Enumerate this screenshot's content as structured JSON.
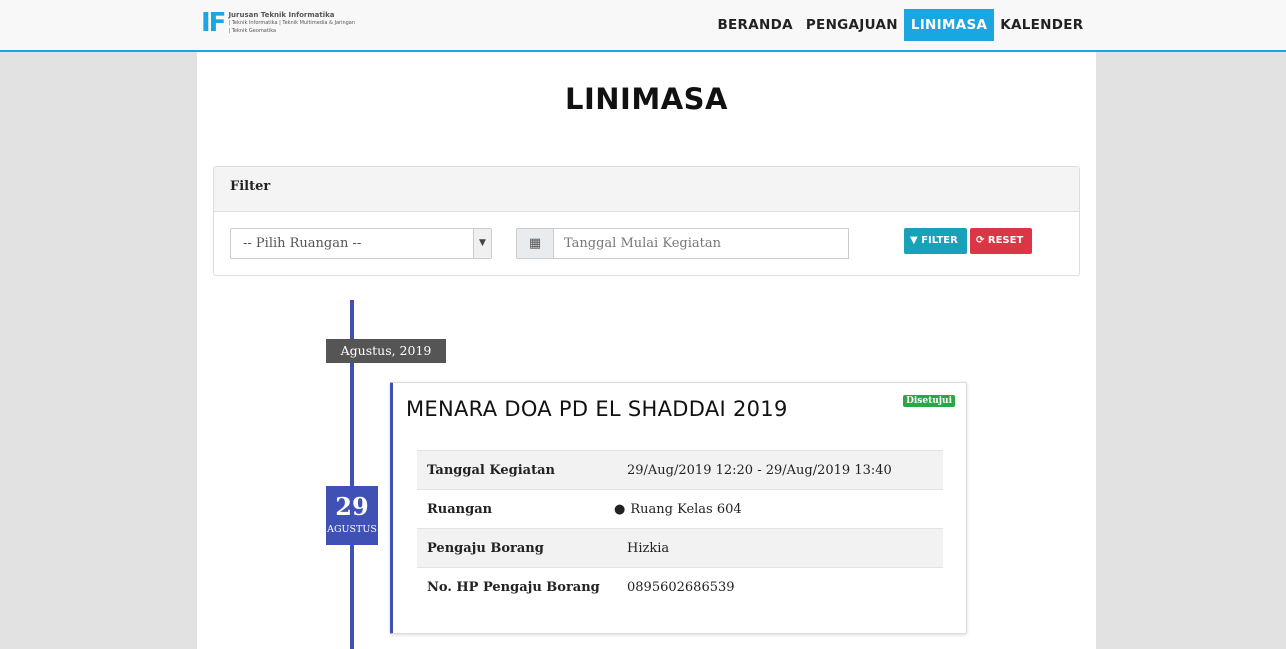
{
  "nav": {
    "brand": {
      "mark": "IF",
      "line1": "Jurusan Teknik Informatika",
      "line2": "| Teknik Informatika | Teknik Multimedia & Jaringan",
      "line3": "| Teknik Geomatika"
    },
    "items": [
      {
        "label": "BERANDA",
        "active": false
      },
      {
        "label": "PENGAJUAN",
        "active": false
      },
      {
        "label": "LINIMASA",
        "active": true
      },
      {
        "label": "KALENDER",
        "active": false
      }
    ],
    "accent_color": "#1aa6e0"
  },
  "page": {
    "title": "LINIMASA"
  },
  "filter": {
    "heading": "Filter",
    "room_select_value": "-- Pilih Ruangan --",
    "date_placeholder": "Tanggal Mulai Kegiatan",
    "calendar_icon": "calendar-icon",
    "filter_button": "FILTER",
    "reset_button": "RESET",
    "filter_color": "#17a2b8",
    "reset_color": "#dc3545"
  },
  "timeline": {
    "month": "Agustus, 2019",
    "day": "29",
    "day_month": "AGUSTUS",
    "line_color": "#3f51b5",
    "event": {
      "title": "MENARA DOA PD EL SHADDAI 2019",
      "status": "Disetujui",
      "status_color": "#28a745",
      "details": [
        {
          "label": "Tanggal Kegiatan",
          "value": "29/Aug/2019 12:20 - 29/Aug/2019 13:40"
        },
        {
          "label": "Ruangan",
          "value": "Ruang Kelas 604"
        },
        {
          "label": "Pengaju Borang",
          "value": "Hizkia"
        },
        {
          "label": "No. HP Pengaju Borang",
          "value": "0895602686539"
        }
      ]
    }
  }
}
